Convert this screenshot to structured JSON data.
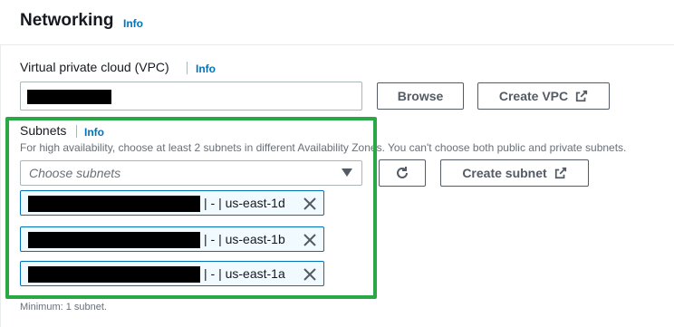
{
  "section": {
    "title": "Networking",
    "info": "Info"
  },
  "vpc": {
    "label": "Virtual private cloud (VPC)",
    "info": "Info",
    "browse_label": "Browse",
    "create_label": "Create VPC"
  },
  "subnets": {
    "label": "Subnets",
    "info": "Info",
    "description": "For high availability, choose at least 2 subnets in different Availability Zones. You can't choose both public and private subnets.",
    "placeholder": "Choose subnets",
    "create_label": "Create subnet",
    "selected": [
      {
        "suffix": "| - | us-east-1d"
      },
      {
        "suffix": "| - | us-east-1b"
      },
      {
        "suffix": "| - | us-east-1a"
      }
    ],
    "constraint": "Minimum: 1 subnet."
  },
  "colors": {
    "highlight": "#2aa846",
    "link": "#0073bb"
  },
  "icons": {
    "external": "external-link-icon",
    "refresh": "refresh-icon",
    "caret": "caret-down-icon",
    "remove": "close-icon"
  }
}
